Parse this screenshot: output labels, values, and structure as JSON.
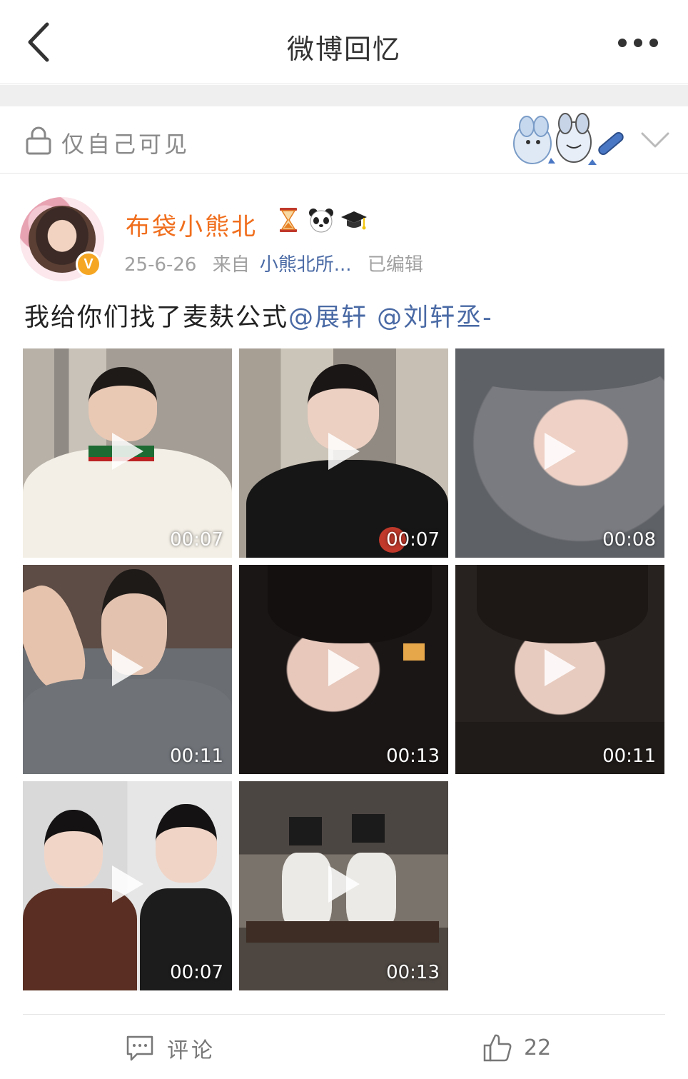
{
  "header": {
    "title": "微博回忆"
  },
  "privacy": {
    "label": "仅自己可见"
  },
  "post": {
    "username": "布袋小熊北",
    "user_emojis": [
      "hourglass-emoji",
      "panda-emoji",
      "graduation-cap-emoji"
    ],
    "date": "25-6-26",
    "source_prefix": "来自",
    "source": "小熊北所...",
    "edited": "已编辑",
    "text": "我给你们找了麦麸公式",
    "mentions": [
      "@展轩",
      "@刘轩丞-"
    ],
    "videos": [
      {
        "duration": "00:07"
      },
      {
        "duration": "00:07"
      },
      {
        "duration": "00:08"
      },
      {
        "duration": "00:11"
      },
      {
        "duration": "00:13"
      },
      {
        "duration": "00:11"
      },
      {
        "duration": "00:07"
      },
      {
        "duration": "00:13"
      }
    ]
  },
  "actions": {
    "comment_label": "评论",
    "like_count": "22"
  },
  "colors": {
    "username": "#f06e1d",
    "link": "#4a6aa5",
    "verified": "#f5a623"
  }
}
